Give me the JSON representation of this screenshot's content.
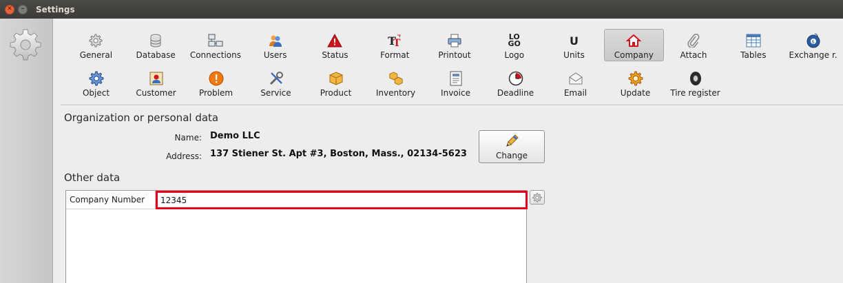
{
  "window": {
    "title": "Settings"
  },
  "toolbar": {
    "row1": [
      {
        "label": "General",
        "icon": "gear-icon"
      },
      {
        "label": "Database",
        "icon": "database-icon"
      },
      {
        "label": "Connections",
        "icon": "network-icon"
      },
      {
        "label": "Users",
        "icon": "users-icon"
      },
      {
        "label": "Status",
        "icon": "warning-icon"
      },
      {
        "label": "Format",
        "icon": "format-icon"
      },
      {
        "label": "Printout",
        "icon": "printer-icon"
      },
      {
        "label": "Logo",
        "icon": "logo-icon",
        "glyph_top": "LO",
        "glyph_bottom": "GO"
      },
      {
        "label": "Units",
        "icon": "units-icon",
        "glyph": "U"
      },
      {
        "label": "Company",
        "icon": "house-icon",
        "selected": true
      },
      {
        "label": "Attach",
        "icon": "paperclip-icon"
      },
      {
        "label": "Tables",
        "icon": "table-icon"
      },
      {
        "label": "Exchange r.",
        "icon": "exchange-icon"
      }
    ],
    "row2": [
      {
        "label": "Object",
        "icon": "cog-blue-icon"
      },
      {
        "label": "Customer",
        "icon": "customer-icon"
      },
      {
        "label": "Problem",
        "icon": "problem-icon"
      },
      {
        "label": "Service",
        "icon": "tools-icon"
      },
      {
        "label": "Product",
        "icon": "box-icon"
      },
      {
        "label": "Inventory",
        "icon": "boxes-icon"
      },
      {
        "label": "Invoice",
        "icon": "invoice-icon"
      },
      {
        "label": "Deadline",
        "icon": "clock-icon"
      },
      {
        "label": "Email",
        "icon": "envelope-icon"
      },
      {
        "label": "Update",
        "icon": "update-icon"
      },
      {
        "label": "Tire register",
        "icon": "tire-icon"
      }
    ]
  },
  "org": {
    "section_title": "Organization or personal data",
    "name_label": "Name:",
    "name_value": "Demo LLC",
    "address_label": "Address:",
    "address_value": "137 Stiener St. Apt #3, Boston, Mass., 02134-5623",
    "change_label": "Change"
  },
  "other": {
    "section_title": "Other data",
    "company_number_label": "Company Number",
    "company_number_value": "12345"
  },
  "colors": {
    "highlight": "#e8001c",
    "selected_bg": "#d2d2d2"
  }
}
